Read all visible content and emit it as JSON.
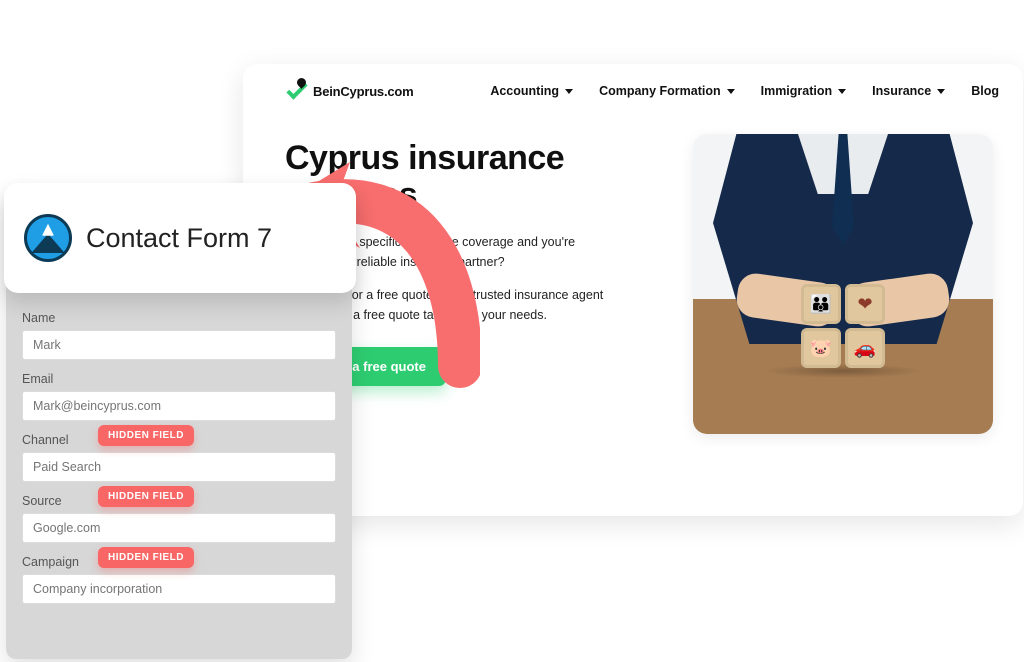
{
  "site": {
    "logo_text": "BeinCyprus.com",
    "nav": {
      "accounting": "Accounting",
      "company_formation": "Company Formation",
      "immigration": "Immigration",
      "insurance": "Insurance",
      "blog": "Blog"
    },
    "hero": {
      "title": "Cyprus insurance services",
      "p1": "Do you need specific insurance coverage and you're looking for a reliable insurance partner?",
      "p2": "Contact us for a free quote with a trusted insurance agent and receive a free quote tailored to your needs.",
      "cta": "Get a free quote"
    }
  },
  "form": {
    "app_title": "Contact Form 7",
    "hidden_label": "HIDDEN FIELD",
    "fields": {
      "name": {
        "label": "Name",
        "placeholder": "Mark"
      },
      "email": {
        "label": "Email",
        "placeholder": "Mark@beincyprus.com"
      },
      "channel": {
        "label": "Channel",
        "placeholder": "Paid Search"
      },
      "source": {
        "label": "Source",
        "placeholder": "Google.com"
      },
      "campaign": {
        "label": "Campaign",
        "placeholder": "Company incorporation"
      }
    }
  }
}
